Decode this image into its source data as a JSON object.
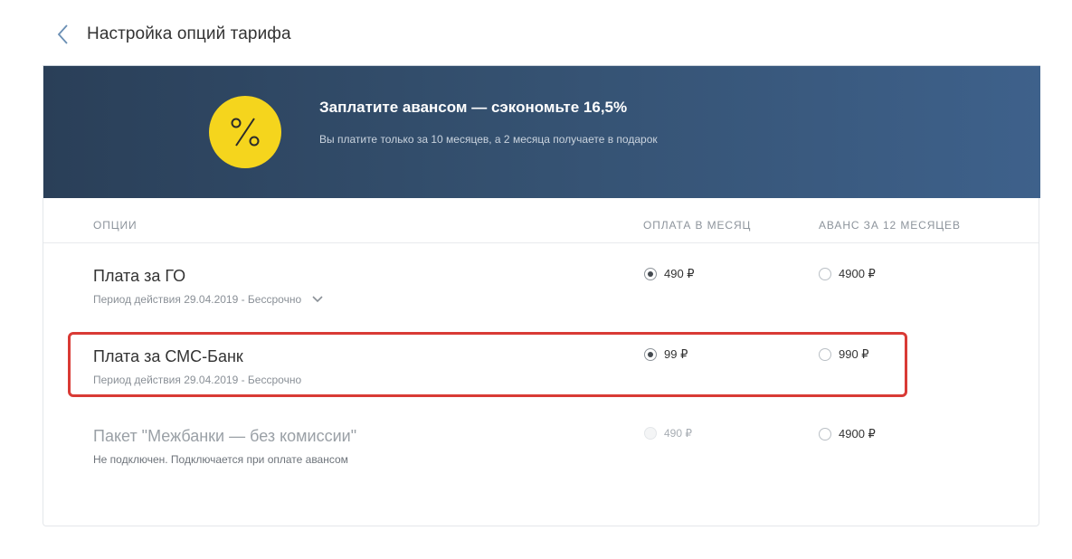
{
  "header": {
    "back_icon": "chevron-left-icon",
    "title": "Настройка опций тарифа"
  },
  "banner": {
    "icon": "percent-icon",
    "title": "Заплатите авансом — сэкономьте 16,5%",
    "subtitle": "Вы платите только за 10 месяцев, а 2 месяца получаете в подарок",
    "colors": {
      "gradient_start": "#2a3f58",
      "gradient_end": "#3e618b",
      "badge": "#f5d51d"
    }
  },
  "table": {
    "columns": [
      "ОПЦИИ",
      "ОПЛАТА В МЕСЯЦ",
      "АВАНС ЗА 12 МЕСЯЦЕВ"
    ],
    "rows": [
      {
        "name": "Плата за ГО",
        "period": "Период действия 29.04.2019 - Бессрочно",
        "expand_icon": "chevron-down-icon",
        "monthly_price": "490 ₽",
        "monthly_selected": true,
        "monthly_disabled": false,
        "advance_price": "4900 ₽",
        "advance_selected": false
      },
      {
        "name": "Плата за СМС-Банк",
        "period": "Период действия 29.04.2019 - Бессрочно",
        "monthly_price": "99 ₽",
        "monthly_selected": true,
        "monthly_disabled": false,
        "advance_price": "990 ₽",
        "advance_selected": false,
        "highlighted": true
      },
      {
        "name": "Пакет \"Межбанки — без комиссии\"",
        "period": "Не подключен. Подключается при оплате авансом",
        "monthly_price": "490 ₽",
        "monthly_selected": false,
        "monthly_disabled": true,
        "advance_price": "4900 ₽",
        "advance_selected": false
      }
    ]
  },
  "colors": {
    "highlight_border": "#d93a35"
  }
}
